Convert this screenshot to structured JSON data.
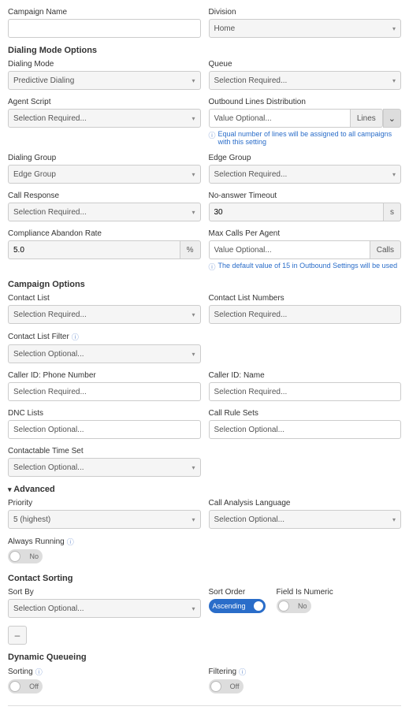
{
  "top": {
    "campaignNameLabel": "Campaign Name",
    "campaignNameValue": "",
    "divisionLabel": "Division",
    "divisionValue": "Home"
  },
  "dialingMode": {
    "sectionTitle": "Dialing Mode Options",
    "dialingModeLabel": "Dialing Mode",
    "dialingModeValue": "Predictive Dialing",
    "queueLabel": "Queue",
    "queueValue": "Selection Required...",
    "agentScriptLabel": "Agent Script",
    "agentScriptValue": "Selection Required...",
    "outboundLinesLabel": "Outbound Lines Distribution",
    "outboundLinesValue": "Value Optional...",
    "outboundLinesSuffix": "Lines",
    "outboundLinesHelp": "Equal number of lines will be assigned to all campaigns with this setting",
    "dialingGroupLabel": "Dialing Group",
    "dialingGroupValue": "Edge Group",
    "edgeGroupLabel": "Edge Group",
    "edgeGroupValue": "Selection Required...",
    "callResponseLabel": "Call Response",
    "callResponseValue": "Selection Required...",
    "noAnswerLabel": "No-answer Timeout",
    "noAnswerValue": "30",
    "noAnswerSuffix": "s",
    "abandonLabel": "Compliance Abandon Rate",
    "abandonValue": "5.0",
    "abandonSuffix": "%",
    "maxCallsLabel": "Max Calls Per Agent",
    "maxCallsValue": "Value Optional...",
    "maxCallsSuffix": "Calls",
    "maxCallsHelp": "The default value of 15 in Outbound Settings will be used"
  },
  "campaignOptions": {
    "sectionTitle": "Campaign Options",
    "contactListLabel": "Contact List",
    "contactListValue": "Selection Required...",
    "contactListNumbersLabel": "Contact List Numbers",
    "contactListNumbersValue": "Selection Required...",
    "contactListFilterLabel": "Contact List Filter",
    "contactListFilterValue": "Selection Optional...",
    "callerIdNumberLabel": "Caller ID: Phone Number",
    "callerIdNumberValue": "Selection Required...",
    "callerIdNameLabel": "Caller ID: Name",
    "callerIdNameValue": "Selection Required...",
    "dncLabel": "DNC Lists",
    "dncValue": "Selection Optional...",
    "callRuleLabel": "Call Rule Sets",
    "callRuleValue": "Selection Optional...",
    "contactableLabel": "Contactable Time Set",
    "contactableValue": "Selection Optional..."
  },
  "advanced": {
    "sectionTitle": "Advanced",
    "priorityLabel": "Priority",
    "priorityValue": "5 (highest)",
    "callAnalysisLabel": "Call Analysis Language",
    "callAnalysisValue": "Selection Optional...",
    "alwaysRunningLabel": "Always Running",
    "alwaysRunningValue": "No"
  },
  "contactSorting": {
    "sectionTitle": "Contact Sorting",
    "sortByLabel": "Sort By",
    "sortByValue": "Selection Optional...",
    "sortOrderLabel": "Sort Order",
    "sortOrderValue": "Ascending",
    "fieldNumericLabel": "Field Is Numeric",
    "fieldNumericValue": "No",
    "minusLabel": "–"
  },
  "dynamicQueueing": {
    "sectionTitle": "Dynamic Queueing",
    "sortingLabel": "Sorting",
    "sortingValue": "Off",
    "filteringLabel": "Filtering",
    "filteringValue": "Off"
  }
}
